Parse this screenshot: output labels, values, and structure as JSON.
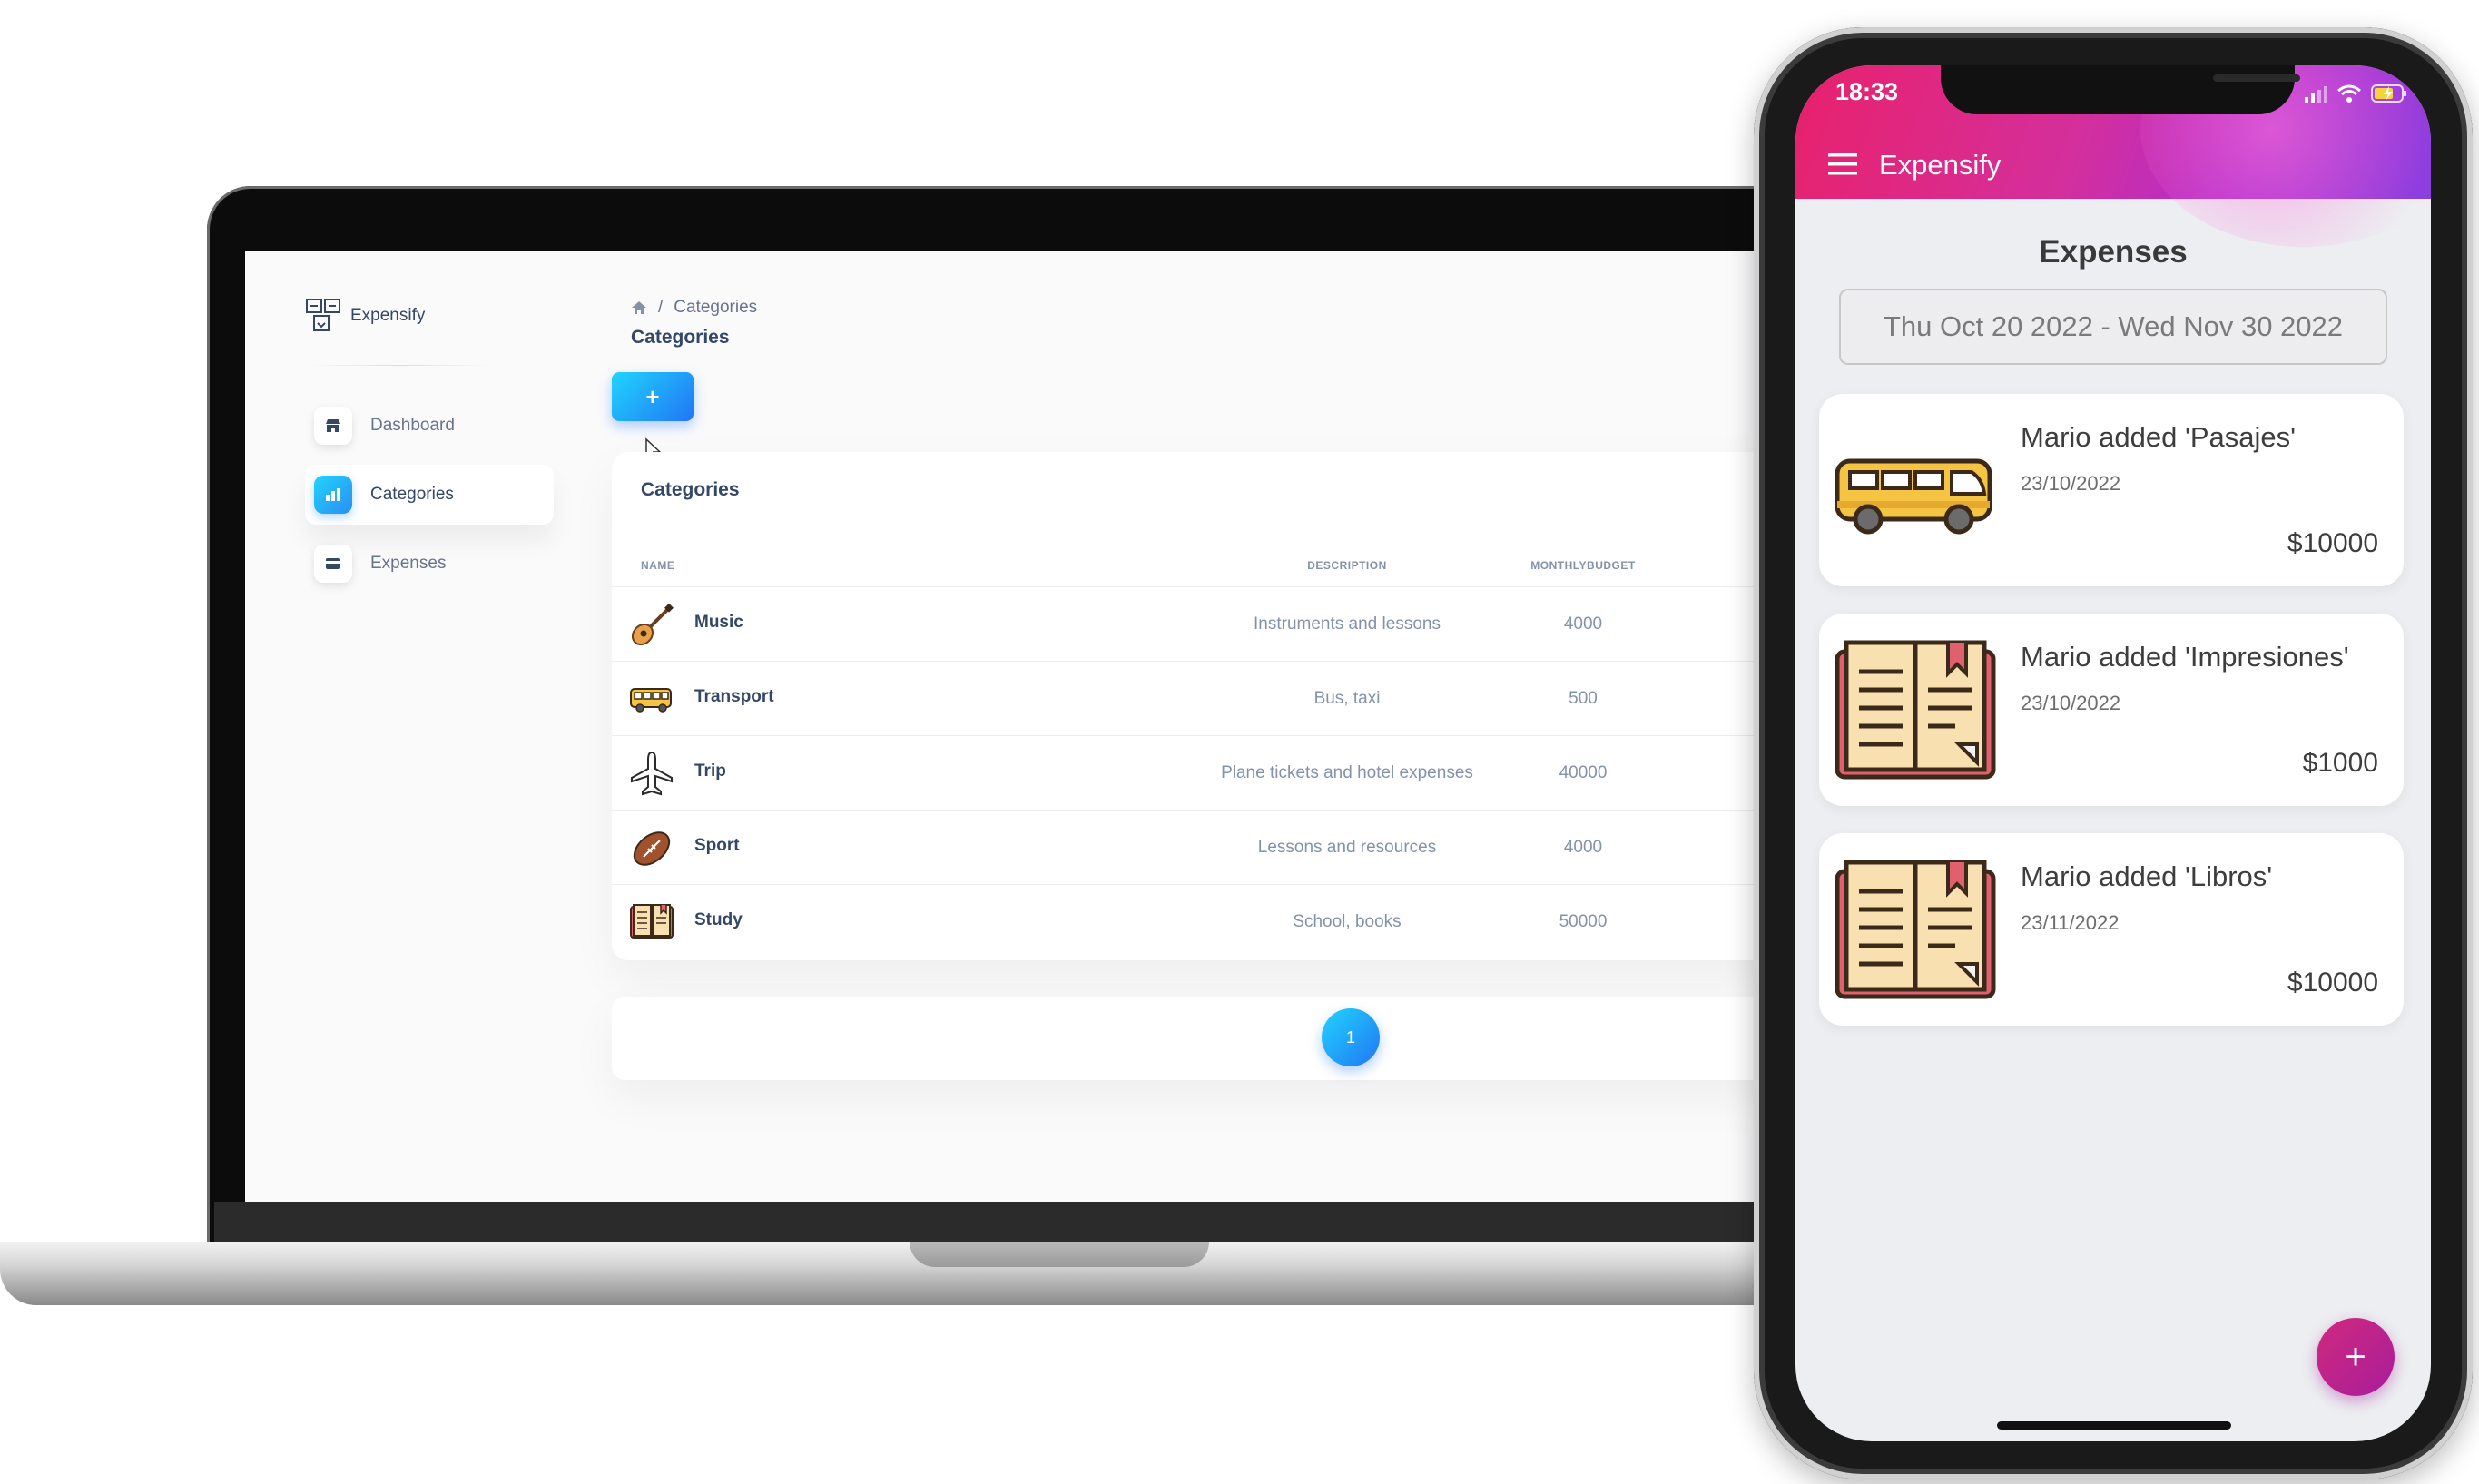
{
  "desktop": {
    "app_name": "Expensify",
    "sidebar": {
      "items": [
        {
          "label": "Dashboard",
          "icon": "store-icon"
        },
        {
          "label": "Categories",
          "icon": "chart-icon",
          "active": true
        },
        {
          "label": "Expenses",
          "icon": "card-icon"
        }
      ]
    },
    "breadcrumb": {
      "separator": "/",
      "current": "Categories"
    },
    "page_title": "Categories",
    "add_button_label": "+",
    "card_title": "Categories",
    "table": {
      "columns": [
        "NAME",
        "DESCRIPTION",
        "MONTHLYBUDGET"
      ],
      "rows": [
        {
          "name": "Music",
          "description": "Instruments and lessons",
          "budget": "4000",
          "icon": "guitar-icon"
        },
        {
          "name": "Transport",
          "description": "Bus, taxi",
          "budget": "500",
          "icon": "bus-icon"
        },
        {
          "name": "Trip",
          "description": "Plane tickets and hotel expenses",
          "budget": "40000",
          "icon": "airplane-icon"
        },
        {
          "name": "Sport",
          "description": "Lessons and resources",
          "budget": "4000",
          "icon": "football-icon"
        },
        {
          "name": "Study",
          "description": "School, books",
          "budget": "50000",
          "icon": "book-icon"
        }
      ]
    },
    "pagination": {
      "current_page": "1"
    }
  },
  "mobile": {
    "status_time": "18:33",
    "app_title": "Expensify",
    "screen_title": "Expenses",
    "date_range": "Thu Oct 20 2022 - Wed Nov 30 2022",
    "expenses": [
      {
        "title": "Mario added 'Pasajes'",
        "date": "23/10/2022",
        "amount": "$10000",
        "icon": "bus-icon"
      },
      {
        "title": "Mario added 'Impresiones'",
        "date": "23/10/2022",
        "amount": "$1000",
        "icon": "book-icon"
      },
      {
        "title": "Mario added 'Libros'",
        "date": "23/11/2022",
        "amount": "$10000",
        "icon": "book-icon"
      }
    ],
    "fab_label": "+"
  },
  "colors": {
    "accent_blue": "#2176f5",
    "header_gradient_start": "#e8216b",
    "header_gradient_end": "#8b3fe0",
    "text_dark": "#344767",
    "text_muted": "#8392ab"
  }
}
